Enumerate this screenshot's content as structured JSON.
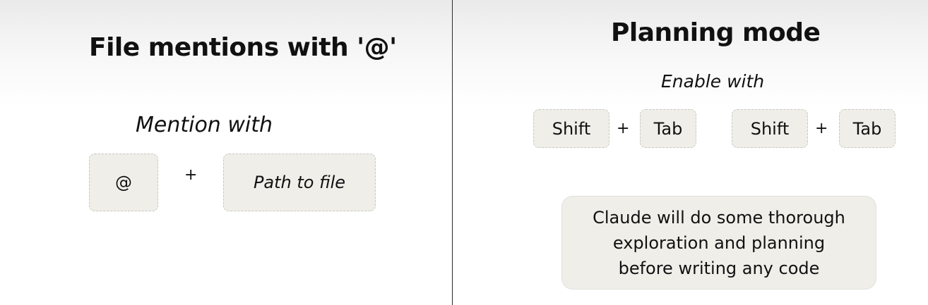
{
  "left_panel": {
    "title": "File mentions with '@'",
    "subtitle": "Mention with",
    "key_at": "@",
    "plus": "+",
    "key_path": "Path to file"
  },
  "right_panel": {
    "title": "Planning mode",
    "subtitle": "Enable with",
    "shortcut": [
      {
        "key1": "Shift",
        "plus": "+",
        "key2": "Tab"
      },
      {
        "key1": "Shift",
        "plus": "+",
        "key2": "Tab"
      }
    ],
    "note_lines": [
      "Claude will do some thorough",
      "exploration and planning",
      "before writing any code"
    ]
  },
  "colors": {
    "key_background": "#efeee9",
    "key_border": "#c9c8c2",
    "text": "#111111",
    "divider": "#2b2b2b"
  }
}
